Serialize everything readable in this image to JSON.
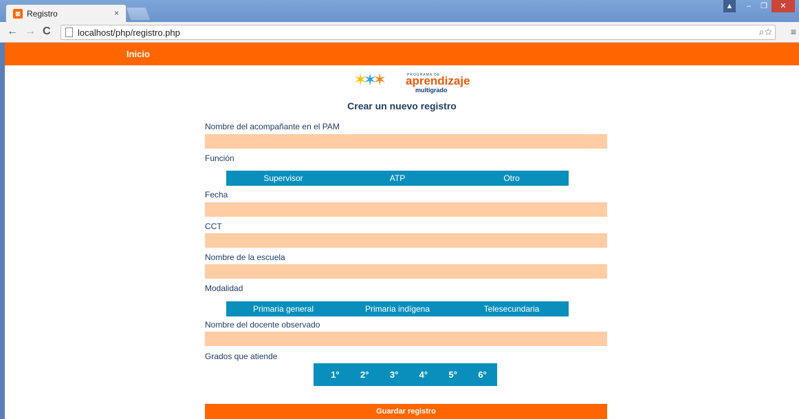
{
  "browser": {
    "tab_title": "Registro",
    "tab_close": "×",
    "url": "localhost/php/registro.php"
  },
  "nav": {
    "inicio": "Inicio"
  },
  "logo": {
    "small": "PROGRAMA DE",
    "main": "aprendizaje",
    "sub": "multigrado"
  },
  "form": {
    "title": "Crear un nuevo registro",
    "nombre_acompanante_label": "Nombre del acompañante en el PAM",
    "funcion_label": "Función",
    "funcion_options": [
      "Supervisor",
      "ATP",
      "Otro"
    ],
    "fecha_label": "Fecha",
    "cct_label": "CCT",
    "escuela_label": "Nombre de la escuela",
    "modalidad_label": "Modalidad",
    "modalidad_options": [
      "Primaria general",
      "Primaria indígena",
      "Telesecundaria"
    ],
    "docente_label": "Nombre del docente observado",
    "grados_label": "Grados que atiende",
    "grados": [
      "1°",
      "2°",
      "3°",
      "4°",
      "5°",
      "6°"
    ],
    "save_label": "Guardar registro"
  },
  "colors": {
    "accent": "#ff6600",
    "option_bar": "#0a8fbd",
    "field": "#ffcca4",
    "label": "#1f3c66"
  }
}
